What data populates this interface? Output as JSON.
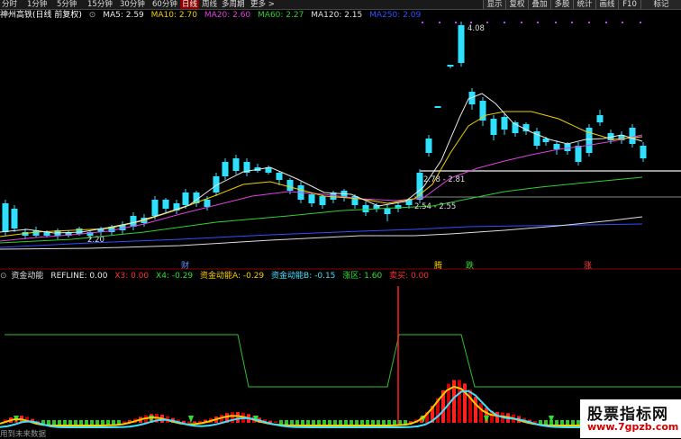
{
  "toolbar": {
    "period_tabs": [
      "分时",
      "1分钟",
      "5分钟",
      "15分钟",
      "30分钟",
      "60分钟",
      "日线",
      "周线",
      "多周期",
      "更多 >"
    ],
    "active_tab": "日线",
    "right_buttons": [
      "显示",
      "复权",
      "叠加",
      "多股",
      "统计",
      "画线",
      "F10",
      "标记"
    ]
  },
  "main_legend": {
    "title": "神州高铁(日线 前复权)",
    "items": [
      {
        "label": "MA5: 2.59",
        "color": "#e8e8e8"
      },
      {
        "label": "MA10: 2.70",
        "color": "#f0d000"
      },
      {
        "label": "MA20: 2.60",
        "color": "#e040e0"
      },
      {
        "label": "MA60: 2.27",
        "color": "#30d030"
      },
      {
        "label": "MA120: 2.15",
        "color": "#e0e0e0"
      },
      {
        "label": "MA250: 2.09",
        "color": "#3050ff"
      }
    ]
  },
  "annotations": {
    "high": "4.08",
    "low": "2.20",
    "range1": "2.78 - 2.81",
    "range2": "2.54 - 2.55"
  },
  "signal_marks": [
    {
      "text": "财",
      "color": "#6090ff"
    },
    {
      "text": "腾",
      "color": "#ffcc00"
    },
    {
      "text": "跌",
      "color": "#30e030"
    },
    {
      "text": "涨",
      "color": "#ff4040"
    }
  ],
  "indicator_legend": {
    "title": "资金动能",
    "items": [
      {
        "label": "REFLINE: 0.00",
        "color": "#e8e8e8"
      },
      {
        "label": "X3: 0.00",
        "color": "#ff3030"
      },
      {
        "label": "X4: -0.29",
        "color": "#30e030"
      },
      {
        "label": "资金动能A: -0.29",
        "color": "#ffcc00"
      },
      {
        "label": "资金动能B: -0.15",
        "color": "#40e0ff"
      },
      {
        "label": "涨区: 1.60",
        "color": "#30e030"
      },
      {
        "label": "卖买: 0.00",
        "color": "#ff3030"
      }
    ]
  },
  "footer_note": "用到未来数据",
  "watermark": {
    "title": "股票指标网",
    "url": "www.7gpzb.com"
  }
}
